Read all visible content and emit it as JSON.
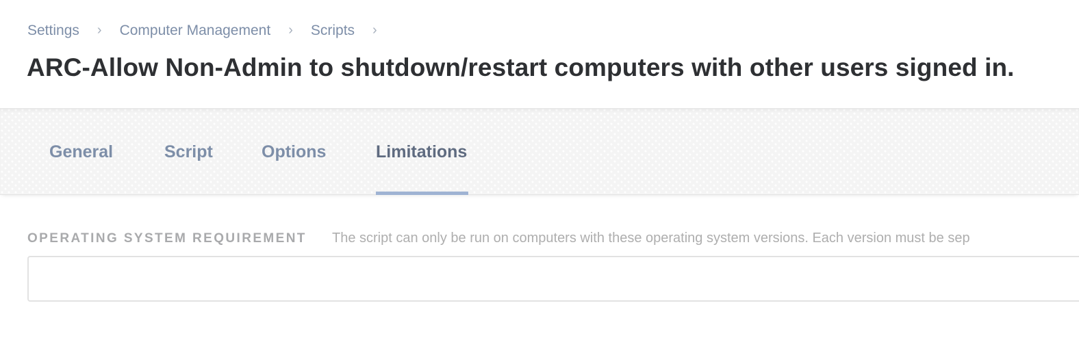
{
  "breadcrumb": {
    "items": [
      {
        "label": "Settings"
      },
      {
        "label": "Computer Management"
      },
      {
        "label": "Scripts"
      }
    ],
    "separator": "›"
  },
  "page": {
    "title": "ARC-Allow Non-Admin to shutdown/restart computers with other users signed in."
  },
  "tabs": [
    {
      "label": "General",
      "active": false
    },
    {
      "label": "Script",
      "active": false
    },
    {
      "label": "Options",
      "active": false
    },
    {
      "label": "Limitations",
      "active": true
    }
  ],
  "limitations": {
    "os_requirement": {
      "label": "OPERATING SYSTEM REQUIREMENT",
      "description": "The script can only be run on computers with these operating system versions. Each version must be sep",
      "value": "",
      "placeholder": ""
    }
  },
  "colors": {
    "link": "#7d8ea8",
    "active_tab": "#5f6b80",
    "tab_underline": "#9fb3d3",
    "title": "#2e3033",
    "muted_label": "#a9aaac"
  }
}
